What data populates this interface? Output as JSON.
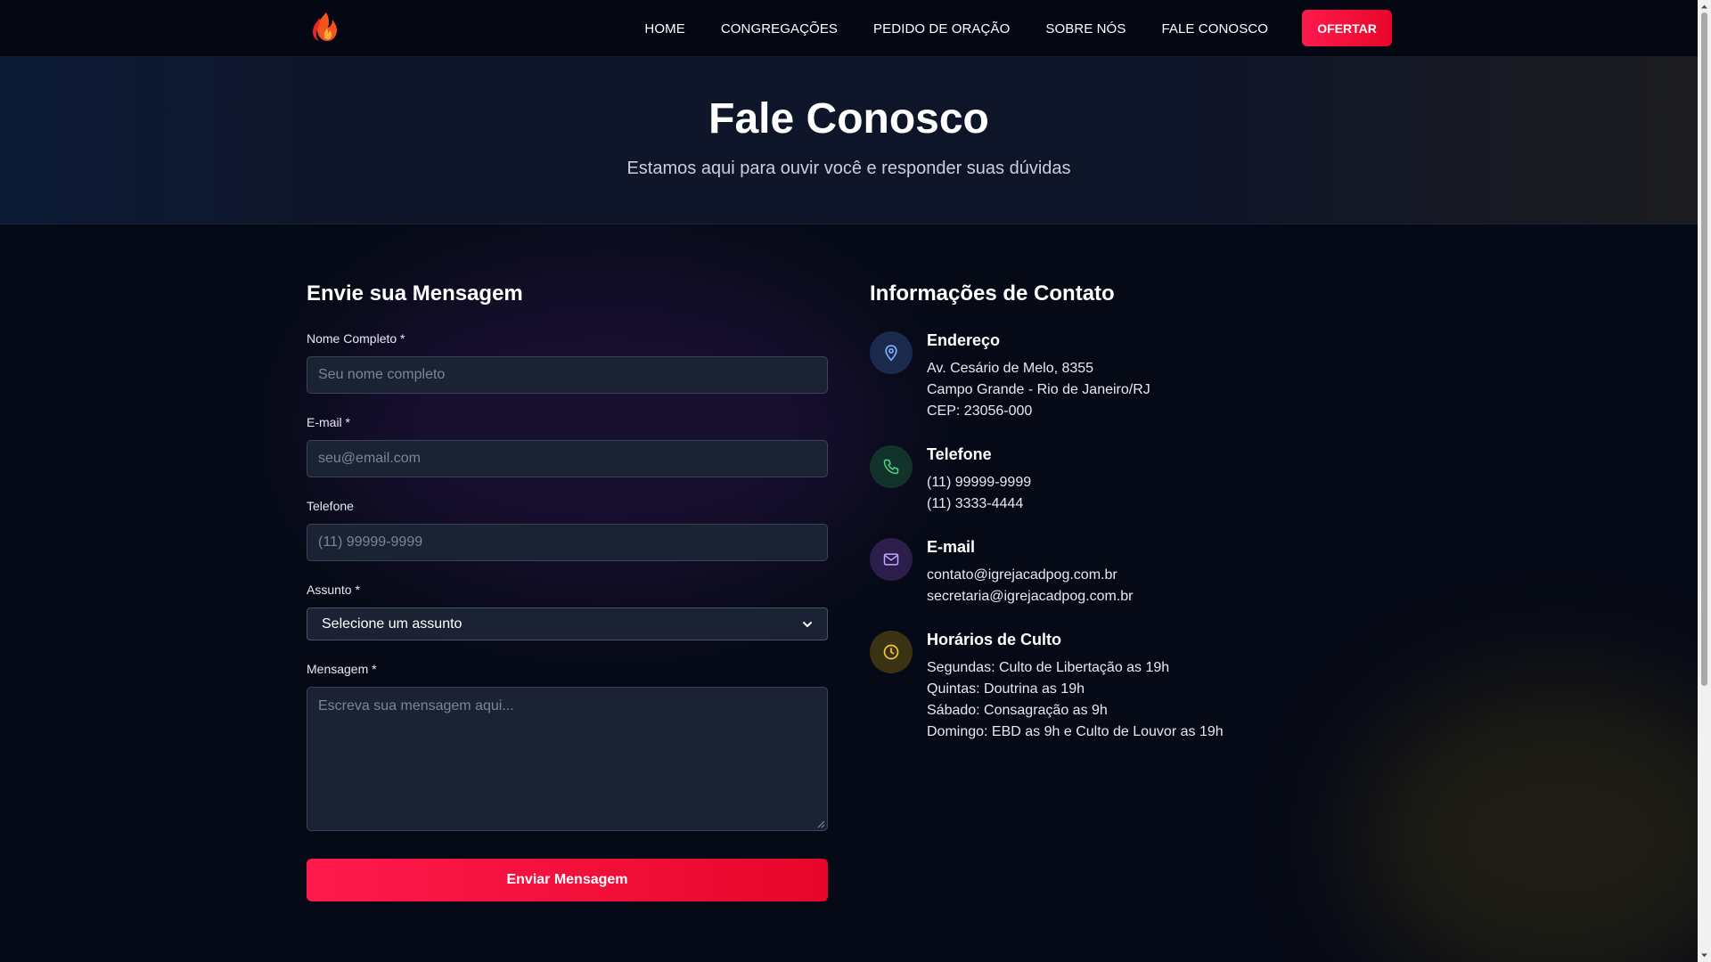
{
  "nav": {
    "logo_icon": "flame-icon",
    "links": [
      "HOME",
      "CONGREGAÇÕES",
      "PEDIDO DE ORAÇÃO",
      "SOBRE NÓS",
      "FALE CONOSCO"
    ],
    "cta": "OFERTAR"
  },
  "hero": {
    "title": "Fale Conosco",
    "subtitle": "Estamos aqui para ouvir você e responder suas dúvidas"
  },
  "form": {
    "title": "Envie sua Mensagem",
    "name_label": "Nome Completo *",
    "name_placeholder": "Seu nome completo",
    "email_label": "E-mail *",
    "email_placeholder": "seu@email.com",
    "phone_label": "Telefone",
    "phone_placeholder": "(11) 99999-9999",
    "subject_label": "Assunto *",
    "subject_selected": "Selecione um assunto",
    "message_label": "Mensagem *",
    "message_placeholder": "Escreva sua mensagem aqui...",
    "submit_label": "Enviar Mensagem"
  },
  "contact": {
    "title": "Informações de Contato",
    "items": [
      {
        "icon": "map-pin-icon",
        "heading": "Endereço",
        "lines": [
          "Av. Cesário de Melo, 8355",
          "Campo Grande - Rio de Janeiro/RJ",
          "CEP: 23056-000"
        ]
      },
      {
        "icon": "phone-icon",
        "heading": "Telefone",
        "lines": [
          "(11) 99999-9999",
          "(11) 3333-4444"
        ]
      },
      {
        "icon": "mail-icon",
        "heading": "E-mail",
        "lines": [
          "contato@igrejacadpog.com.br",
          "secretaria@igrejacadpog.com.br"
        ]
      },
      {
        "icon": "clock-icon",
        "heading": "Horários de Culto",
        "lines": [
          "Segundas: Culto de Libertação as 19h",
          "Quintas: Doutrina as 19h",
          "Sábado: Consagração as 9h",
          "Domingo: EBD as 9h e Culto de Louvor as 19h"
        ]
      }
    ]
  },
  "colors": {
    "accent": "#ff1a4d",
    "background": "#060a16",
    "input_bg": "#1a2234"
  }
}
